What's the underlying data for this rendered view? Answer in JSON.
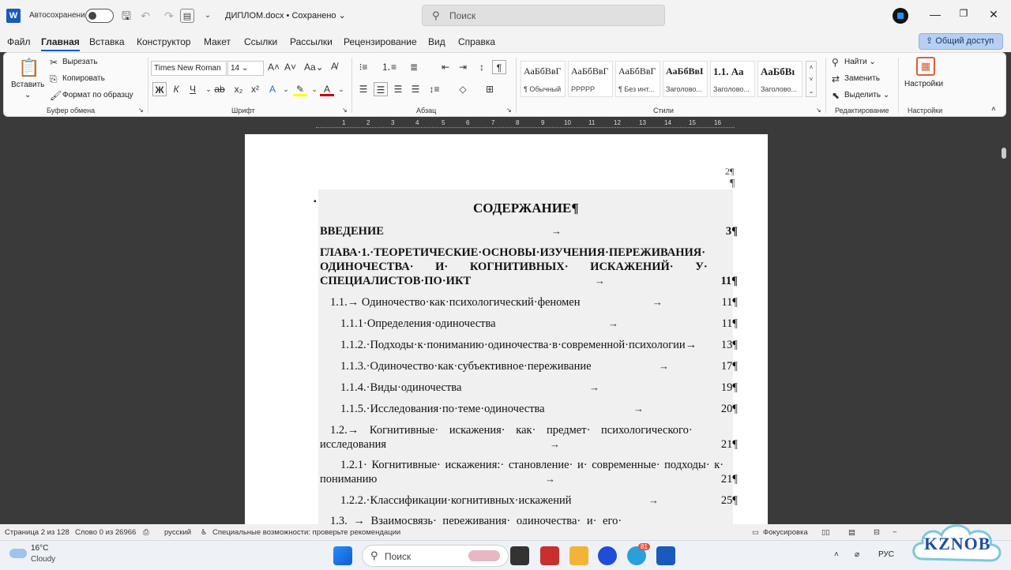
{
  "titlebar": {
    "app_icon": "W",
    "autosave_label": "Автосохранение",
    "doc_name": "ДИПЛОМ.docx • Сохранено",
    "search_placeholder": "Поиск"
  },
  "menu": {
    "tabs": [
      "Файл",
      "Главная",
      "Вставка",
      "Конструктор",
      "Макет",
      "Ссылки",
      "Рассылки",
      "Рецензирование",
      "Вид",
      "Справка"
    ],
    "active": "Главная",
    "share_label": "Общий доступ"
  },
  "ribbon": {
    "clipboard": {
      "paste": "Вставить",
      "cut": "Вырезать",
      "copy": "Копировать",
      "format_painter": "Формат по образцу",
      "label": "Буфер обмена"
    },
    "font": {
      "family": "Times New Roman",
      "size": "14",
      "bold": "Ж",
      "italic": "К",
      "underline": "Ч",
      "label": "Шрифт"
    },
    "paragraph": {
      "label": "Абзац"
    },
    "styles": {
      "items": [
        {
          "sample": "АаБбВвГ",
          "name": "¶ Обычный"
        },
        {
          "sample": "АаБбВвГ",
          "name": "РРРРР"
        },
        {
          "sample": "АаБбВвГ",
          "name": "¶ Без инт..."
        },
        {
          "sample": "АаБбВвI",
          "name": "Заголово..."
        },
        {
          "sample": "1.1.  Аа",
          "name": "Заголово..."
        },
        {
          "sample": "АаБбВı",
          "name": "Заголово..."
        }
      ],
      "label": "Стили"
    },
    "editing": {
      "find": "Найти",
      "replace": "Заменить",
      "select": "Выделить",
      "label": "Редактирование"
    },
    "settings": {
      "button": "Настройки",
      "label": "Настройки"
    }
  },
  "ruler": {
    "ticks": [
      "1",
      "2",
      "3",
      "4",
      "5",
      "6",
      "7",
      "8",
      "9",
      "10",
      "11",
      "12",
      "13",
      "14",
      "15",
      "16"
    ]
  },
  "document": {
    "page_number": "2¶",
    "pilcrow": "¶",
    "heading": "СОДЕРЖАНИЕ¶",
    "toc": {
      "intro": {
        "text": "ВВЕДЕНИЕ",
        "page": "3¶"
      },
      "ch1_line1": "ГЛАВА·1.·ТЕОРЕТИЧЕСКИЕ·ОСНОВЫ·ИЗУЧЕНИЯ·ПЕРЕЖИВАНИЯ·",
      "ch1_line2": "ОДИНОЧЕСТВА·   И·   КОГНИТИВНЫХ·   ИСКАЖЕНИЙ·   У·",
      "ch1_line3": "СПЕЦИАЛИСТОВ·ПО·ИКТ",
      "ch1_page": "11¶",
      "s11": {
        "text": "1.1.→ Одиночество·как·психологический·феномен",
        "page": "11¶"
      },
      "s111": {
        "text": "1.1.1·Определения·одиночества",
        "page": "11¶"
      },
      "s112": {
        "text": "1.1.2.·Подходы·к·пониманию·одиночества·в·современной·психологии→",
        "page": "13¶"
      },
      "s113": {
        "text": "1.1.3.·Одиночество·как·субъективное·переживание",
        "page": "17¶"
      },
      "s114": {
        "text": "1.1.4.·Виды·одиночества",
        "page": "19¶"
      },
      "s115": {
        "text": "1.1.5.·Исследования·по·теме·одиночества",
        "page": "20¶"
      },
      "s12_line1": "1.2.→ Когнитивные·    искажения·    как·    предмет·    психологического·",
      "s12_line2": "исследования",
      "s12_page": "21¶",
      "s121_line1": "1.2.1· Когнитивные· искажения:· становление· и· современные· подходы· к·",
      "s121_line2": "пониманию",
      "s121_page": "21¶",
      "s122": {
        "text": "1.2.2.·Классификации·когнитивных·искажений",
        "page": "25¶"
      },
      "s13_line1": "1.3.      →      Взаимосвязь·   переживания·   одиночества·   и·   его·"
    }
  },
  "statusbar": {
    "page": "Страница 2 из 128",
    "words": "Слово 0 из 26966",
    "language": "русский",
    "accessibility": "Специальные возможности: проверьте рекомендации",
    "focus": "Фокусировка"
  },
  "taskbar": {
    "weather_temp": "16°C",
    "weather_desc": "Cloudy",
    "search_placeholder": "Поиск",
    "lang": "РУС",
    "telegram_badge": "81"
  },
  "watermark": "KZNOB",
  "colors": {
    "accent": "#185abd",
    "share_bg": "#b7cff2",
    "doc_background": "#3a3a3a",
    "highlight": "#ffff00",
    "font_color": "#d00000"
  }
}
